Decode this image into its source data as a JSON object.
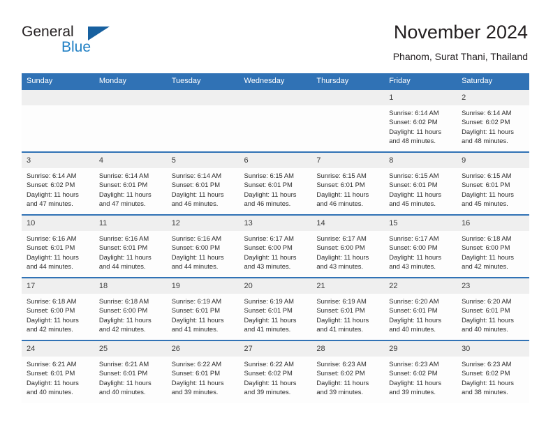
{
  "brand": {
    "name_part1": "General",
    "name_part2": "Blue",
    "flag_color": "#17609f",
    "blue_color": "#1f7fc4"
  },
  "header": {
    "title": "November 2024",
    "location": "Phanom, Surat Thani, Thailand"
  },
  "theme": {
    "header_blue": "#3072b5",
    "daynum_band": "#efefef",
    "cell_background": "#fdfdfd"
  },
  "weekday_headers": [
    "Sunday",
    "Monday",
    "Tuesday",
    "Wednesday",
    "Thursday",
    "Friday",
    "Saturday"
  ],
  "weeks": [
    [
      {
        "day": "",
        "sunrise": "",
        "sunset": "",
        "daylight": "",
        "empty": true
      },
      {
        "day": "",
        "sunrise": "",
        "sunset": "",
        "daylight": "",
        "empty": true
      },
      {
        "day": "",
        "sunrise": "",
        "sunset": "",
        "daylight": "",
        "empty": true
      },
      {
        "day": "",
        "sunrise": "",
        "sunset": "",
        "daylight": "",
        "empty": true
      },
      {
        "day": "",
        "sunrise": "",
        "sunset": "",
        "daylight": "",
        "empty": true
      },
      {
        "day": "1",
        "sunrise": "Sunrise: 6:14 AM",
        "sunset": "Sunset: 6:02 PM",
        "daylight": "Daylight: 11 hours and 48 minutes."
      },
      {
        "day": "2",
        "sunrise": "Sunrise: 6:14 AM",
        "sunset": "Sunset: 6:02 PM",
        "daylight": "Daylight: 11 hours and 48 minutes."
      }
    ],
    [
      {
        "day": "3",
        "sunrise": "Sunrise: 6:14 AM",
        "sunset": "Sunset: 6:02 PM",
        "daylight": "Daylight: 11 hours and 47 minutes."
      },
      {
        "day": "4",
        "sunrise": "Sunrise: 6:14 AM",
        "sunset": "Sunset: 6:01 PM",
        "daylight": "Daylight: 11 hours and 47 minutes."
      },
      {
        "day": "5",
        "sunrise": "Sunrise: 6:14 AM",
        "sunset": "Sunset: 6:01 PM",
        "daylight": "Daylight: 11 hours and 46 minutes."
      },
      {
        "day": "6",
        "sunrise": "Sunrise: 6:15 AM",
        "sunset": "Sunset: 6:01 PM",
        "daylight": "Daylight: 11 hours and 46 minutes."
      },
      {
        "day": "7",
        "sunrise": "Sunrise: 6:15 AM",
        "sunset": "Sunset: 6:01 PM",
        "daylight": "Daylight: 11 hours and 46 minutes."
      },
      {
        "day": "8",
        "sunrise": "Sunrise: 6:15 AM",
        "sunset": "Sunset: 6:01 PM",
        "daylight": "Daylight: 11 hours and 45 minutes."
      },
      {
        "day": "9",
        "sunrise": "Sunrise: 6:15 AM",
        "sunset": "Sunset: 6:01 PM",
        "daylight": "Daylight: 11 hours and 45 minutes."
      }
    ],
    [
      {
        "day": "10",
        "sunrise": "Sunrise: 6:16 AM",
        "sunset": "Sunset: 6:01 PM",
        "daylight": "Daylight: 11 hours and 44 minutes."
      },
      {
        "day": "11",
        "sunrise": "Sunrise: 6:16 AM",
        "sunset": "Sunset: 6:01 PM",
        "daylight": "Daylight: 11 hours and 44 minutes."
      },
      {
        "day": "12",
        "sunrise": "Sunrise: 6:16 AM",
        "sunset": "Sunset: 6:00 PM",
        "daylight": "Daylight: 11 hours and 44 minutes."
      },
      {
        "day": "13",
        "sunrise": "Sunrise: 6:17 AM",
        "sunset": "Sunset: 6:00 PM",
        "daylight": "Daylight: 11 hours and 43 minutes."
      },
      {
        "day": "14",
        "sunrise": "Sunrise: 6:17 AM",
        "sunset": "Sunset: 6:00 PM",
        "daylight": "Daylight: 11 hours and 43 minutes."
      },
      {
        "day": "15",
        "sunrise": "Sunrise: 6:17 AM",
        "sunset": "Sunset: 6:00 PM",
        "daylight": "Daylight: 11 hours and 43 minutes."
      },
      {
        "day": "16",
        "sunrise": "Sunrise: 6:18 AM",
        "sunset": "Sunset: 6:00 PM",
        "daylight": "Daylight: 11 hours and 42 minutes."
      }
    ],
    [
      {
        "day": "17",
        "sunrise": "Sunrise: 6:18 AM",
        "sunset": "Sunset: 6:00 PM",
        "daylight": "Daylight: 11 hours and 42 minutes."
      },
      {
        "day": "18",
        "sunrise": "Sunrise: 6:18 AM",
        "sunset": "Sunset: 6:00 PM",
        "daylight": "Daylight: 11 hours and 42 minutes."
      },
      {
        "day": "19",
        "sunrise": "Sunrise: 6:19 AM",
        "sunset": "Sunset: 6:01 PM",
        "daylight": "Daylight: 11 hours and 41 minutes."
      },
      {
        "day": "20",
        "sunrise": "Sunrise: 6:19 AM",
        "sunset": "Sunset: 6:01 PM",
        "daylight": "Daylight: 11 hours and 41 minutes."
      },
      {
        "day": "21",
        "sunrise": "Sunrise: 6:19 AM",
        "sunset": "Sunset: 6:01 PM",
        "daylight": "Daylight: 11 hours and 41 minutes."
      },
      {
        "day": "22",
        "sunrise": "Sunrise: 6:20 AM",
        "sunset": "Sunset: 6:01 PM",
        "daylight": "Daylight: 11 hours and 40 minutes."
      },
      {
        "day": "23",
        "sunrise": "Sunrise: 6:20 AM",
        "sunset": "Sunset: 6:01 PM",
        "daylight": "Daylight: 11 hours and 40 minutes."
      }
    ],
    [
      {
        "day": "24",
        "sunrise": "Sunrise: 6:21 AM",
        "sunset": "Sunset: 6:01 PM",
        "daylight": "Daylight: 11 hours and 40 minutes."
      },
      {
        "day": "25",
        "sunrise": "Sunrise: 6:21 AM",
        "sunset": "Sunset: 6:01 PM",
        "daylight": "Daylight: 11 hours and 40 minutes."
      },
      {
        "day": "26",
        "sunrise": "Sunrise: 6:22 AM",
        "sunset": "Sunset: 6:01 PM",
        "daylight": "Daylight: 11 hours and 39 minutes."
      },
      {
        "day": "27",
        "sunrise": "Sunrise: 6:22 AM",
        "sunset": "Sunset: 6:02 PM",
        "daylight": "Daylight: 11 hours and 39 minutes."
      },
      {
        "day": "28",
        "sunrise": "Sunrise: 6:23 AM",
        "sunset": "Sunset: 6:02 PM",
        "daylight": "Daylight: 11 hours and 39 minutes."
      },
      {
        "day": "29",
        "sunrise": "Sunrise: 6:23 AM",
        "sunset": "Sunset: 6:02 PM",
        "daylight": "Daylight: 11 hours and 39 minutes."
      },
      {
        "day": "30",
        "sunrise": "Sunrise: 6:23 AM",
        "sunset": "Sunset: 6:02 PM",
        "daylight": "Daylight: 11 hours and 38 minutes."
      }
    ]
  ]
}
